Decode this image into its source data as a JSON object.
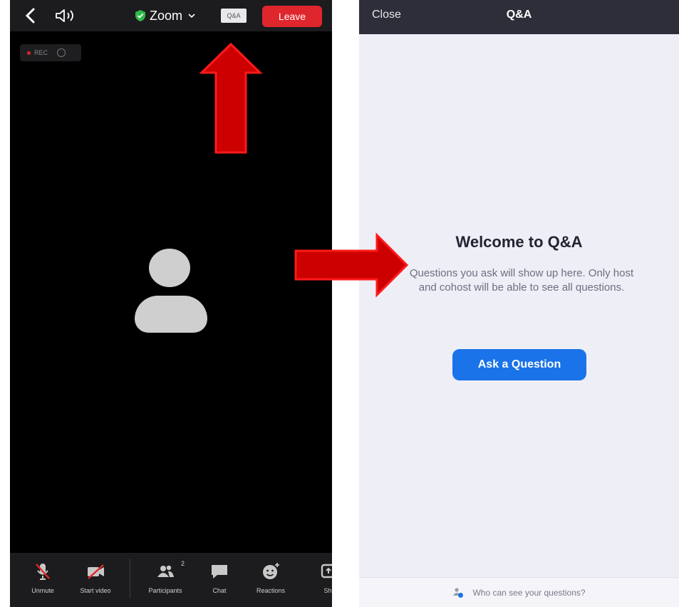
{
  "meeting": {
    "title": "Zoom",
    "qa_button_label": "Q&A",
    "leave_label": "Leave",
    "rec_label": "REC",
    "participant_count": "2",
    "toolbar": [
      {
        "label": "Unmute",
        "icon": "microphone-muted-icon"
      },
      {
        "label": "Start video",
        "icon": "video-off-icon"
      },
      {
        "label": "Participants",
        "icon": "participants-icon"
      },
      {
        "label": "Chat",
        "icon": "chat-icon"
      },
      {
        "label": "Reactions",
        "icon": "reactions-icon"
      },
      {
        "label": "Sh",
        "icon": "share-icon"
      }
    ]
  },
  "qa_panel": {
    "close_label": "Close",
    "title": "Q&A",
    "welcome_title": "Welcome to Q&A",
    "welcome_description": "Questions you ask will show up here. Only host and cohost will be able to see all questions.",
    "ask_button_label": "Ask a Question",
    "footer_text": "Who can see your questions?"
  },
  "colors": {
    "leave": "#e0262d",
    "ask_button": "#1a73e8",
    "annotation_arrow": "#cc0000"
  }
}
